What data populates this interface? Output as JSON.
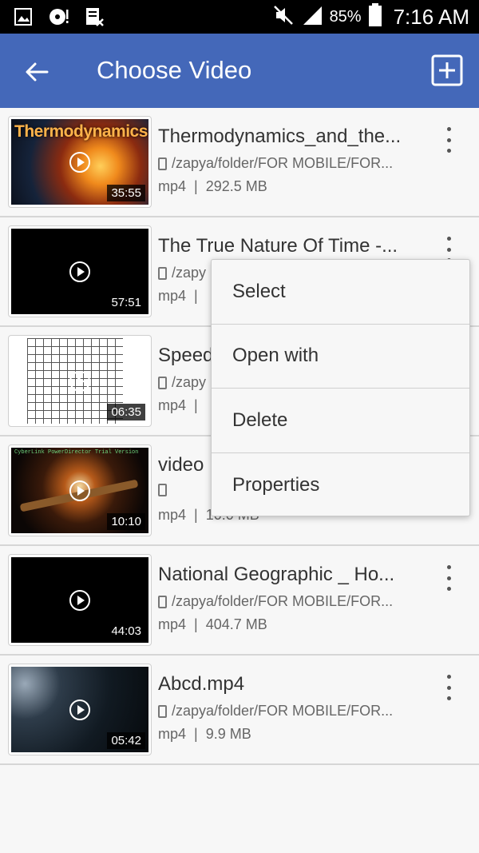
{
  "status_bar": {
    "battery": "85%",
    "time": "7:16 AM"
  },
  "app_bar": {
    "title": "Choose Video",
    "back_icon": "arrow-left-icon",
    "add_icon": "plus-square-icon"
  },
  "videos": [
    {
      "name": "Thermodynamics_and_the...",
      "path": "/zapya/folder/FOR MOBILE/FOR...",
      "format": "mp4",
      "size": "292.5 MB",
      "duration": "35:55",
      "thumb_text": "Thermodynamics"
    },
    {
      "name": "The True Nature Of Time -...",
      "path": "/zapy",
      "format": "mp4",
      "size": "",
      "duration": "57:51"
    },
    {
      "name": "Speed",
      "path": "/zapy",
      "format": "mp4",
      "size": "",
      "duration": "06:35"
    },
    {
      "name": "video",
      "path": "",
      "format": "mp4",
      "size": "10.0 MB",
      "duration": "10:10",
      "thumb_text": "CyberLink PowerDirector Trial Version"
    },
    {
      "name": "National Geographic _ Ho...",
      "path": "/zapya/folder/FOR MOBILE/FOR...",
      "format": "mp4",
      "size": "404.7 MB",
      "duration": "44:03"
    },
    {
      "name": "Abcd.mp4",
      "path": "/zapya/folder/FOR MOBILE/FOR...",
      "format": "mp4",
      "size": "9.9 MB",
      "duration": "05:42"
    }
  ],
  "context_menu": {
    "items": [
      "Select",
      "Open with",
      "Delete",
      "Properties"
    ]
  }
}
